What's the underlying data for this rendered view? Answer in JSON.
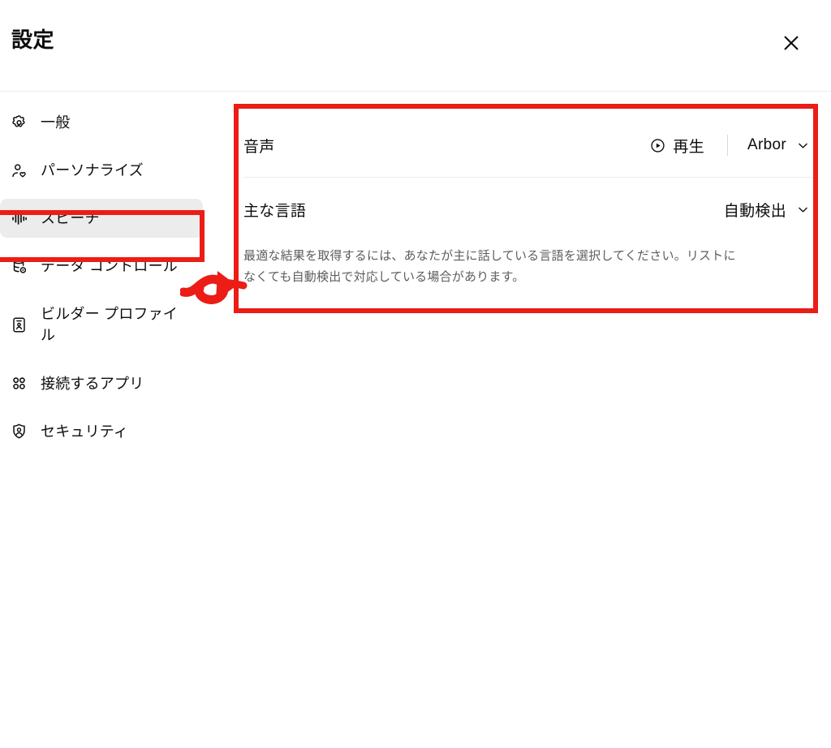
{
  "header": {
    "title": "設定",
    "close_label": "閉じる",
    "close_icon": "close-icon"
  },
  "sidebar": {
    "items": [
      {
        "id": "general",
        "label": "一般",
        "icon": "gear-icon",
        "selected": false,
        "wrap": false
      },
      {
        "id": "personalize",
        "label": "パーソナライズ",
        "icon": "person-heart-icon",
        "selected": false,
        "wrap": false
      },
      {
        "id": "speech",
        "label": "スピーチ",
        "icon": "waveform-icon",
        "selected": true,
        "wrap": false
      },
      {
        "id": "data-controls",
        "label": "データ コントロール",
        "icon": "database-gear-icon",
        "selected": false,
        "wrap": true
      },
      {
        "id": "builder-profile",
        "label": "ビルダー プロファイル",
        "icon": "id-card-icon",
        "selected": false,
        "wrap": true
      },
      {
        "id": "connected-apps",
        "label": "接続するアプリ",
        "icon": "grid-dots-icon",
        "selected": false,
        "wrap": false
      },
      {
        "id": "security",
        "label": "セキュリティ",
        "icon": "shield-person-icon",
        "selected": false,
        "wrap": false
      }
    ]
  },
  "main": {
    "voice_row": {
      "label": "音声",
      "play_label": "再生",
      "play_icon": "play-circle-icon",
      "voice_value": "Arbor",
      "voice_chevron_icon": "chevron-down-icon"
    },
    "language_row": {
      "label": "主な言語",
      "value": "自動検出",
      "chevron_icon": "chevron-down-icon"
    },
    "description": "最適な結果を取得するには、あなたが主に話している言語を選択してください。リストになくても自動検出で対応している場合があります。"
  },
  "annotations": {
    "color": "#ec1c16",
    "sidebar_highlight": "スピーチ",
    "panel_highlight": "speech-settings-panel",
    "arrow": "arrow-right"
  }
}
